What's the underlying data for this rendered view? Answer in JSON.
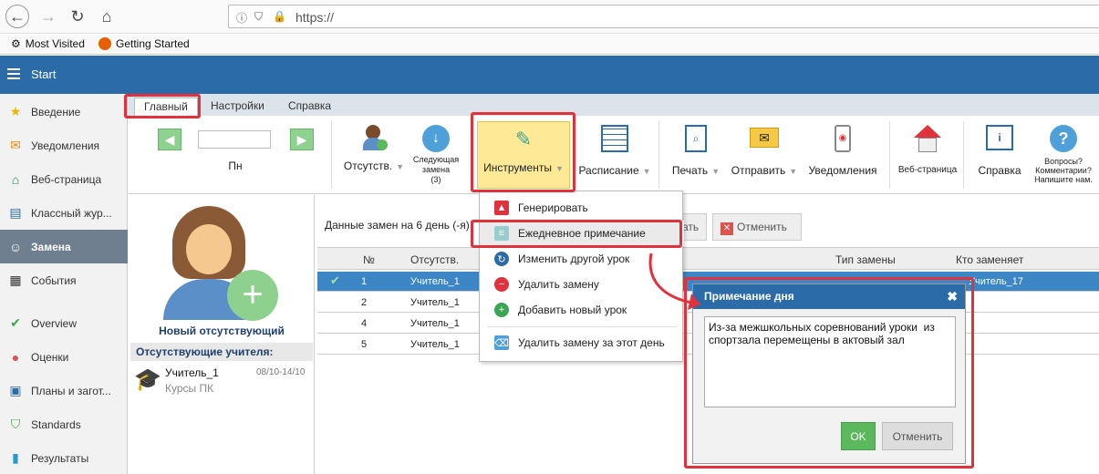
{
  "browser": {
    "url": "https://",
    "bookmarks": [
      "Most Visited",
      "Getting Started"
    ]
  },
  "app": {
    "title": "Start",
    "header_color": "#2b6ca8"
  },
  "sidebar": {
    "items": [
      {
        "label": "Введение",
        "icon": "star-icon",
        "color": "#f0b400"
      },
      {
        "label": "Уведомления",
        "icon": "envelope-icon",
        "color": "#f08a00"
      },
      {
        "label": "Веб-страница",
        "icon": "home-icon",
        "color": "#1f8a4c"
      },
      {
        "label": "Классный жур...",
        "icon": "book-icon",
        "color": "#2b6ca8"
      },
      {
        "label": "Замена",
        "icon": "user-icon",
        "active": true
      },
      {
        "label": "События",
        "icon": "calendar-icon",
        "color": "#333"
      },
      {
        "label": "Overview",
        "icon": "check-circle-icon",
        "color": "#3aa655"
      },
      {
        "label": "Оценки",
        "icon": "grade-icon",
        "color": "#d9534f"
      },
      {
        "label": "Планы и загот...",
        "icon": "briefcase-icon",
        "color": "#2b6ca8"
      },
      {
        "label": "Standards",
        "icon": "shield-icon",
        "color": "#3aa655"
      },
      {
        "label": "Результаты",
        "icon": "bar-chart-icon",
        "color": "#2b9acb"
      }
    ]
  },
  "ribbon": {
    "tabs": [
      "Главный",
      "Настройки",
      "Справка"
    ],
    "day": "Пн",
    "buttons": {
      "absence": "Отсутств.",
      "next_sub_1": "Следующая",
      "next_sub_2": "замена",
      "next_sub_3": "(3)",
      "tools": "Инструменты",
      "schedule": "Расписание",
      "print": "Печать",
      "send": "Отправить",
      "notifications": "Уведомления",
      "webpage": "Веб-страница",
      "help": "Справка",
      "questions_1": "Вопросы?",
      "questions_2": "Комментарии?",
      "questions_3": "Напишите нам."
    }
  },
  "absent": {
    "new_label": "Новый отсутствующий",
    "header": "Отсутствующие учителя:",
    "teacher_name": "Учитель_1",
    "teacher_dates": "08/10-14/10",
    "teacher_reason": "Курсы ПК"
  },
  "main": {
    "caption": "Данные замен на 6 день (-я)",
    "btn_partial": "ать",
    "btn_cancel": "Отменить",
    "columns": {
      "num": "№",
      "absent": "Отсутств.",
      "type": "Тип замены",
      "who": "Кто заменяет"
    },
    "rows": [
      {
        "num": "1",
        "teacher": "Учитель_1",
        "who": "Учитель_17",
        "selected": true
      },
      {
        "num": "2",
        "teacher": "Учитель_1",
        "who": ""
      },
      {
        "num": "4",
        "teacher": "Учитель_1",
        "who": ""
      },
      {
        "num": "5",
        "teacher": "Учитель_1",
        "who": ""
      }
    ]
  },
  "tools_menu": {
    "items": [
      {
        "label": "Генерировать",
        "icon": "generate-icon"
      },
      {
        "label": "Ежедневное примечание",
        "icon": "note-icon",
        "highlighted": true
      },
      {
        "label": "Изменить другой урок",
        "icon": "refresh-icon"
      },
      {
        "label": "Удалить замену",
        "icon": "remove-icon"
      },
      {
        "label": "Добавить новый урок",
        "icon": "add-icon"
      },
      {
        "label": "Удалить замену за этот день",
        "icon": "delete-day-icon"
      }
    ]
  },
  "note_dialog": {
    "title": "Примечание дня",
    "text": "Из-за межшкольных соревнований уроки  из спортзала перемещены в актовый зал",
    "ok": "OK",
    "cancel": "Отменить"
  }
}
